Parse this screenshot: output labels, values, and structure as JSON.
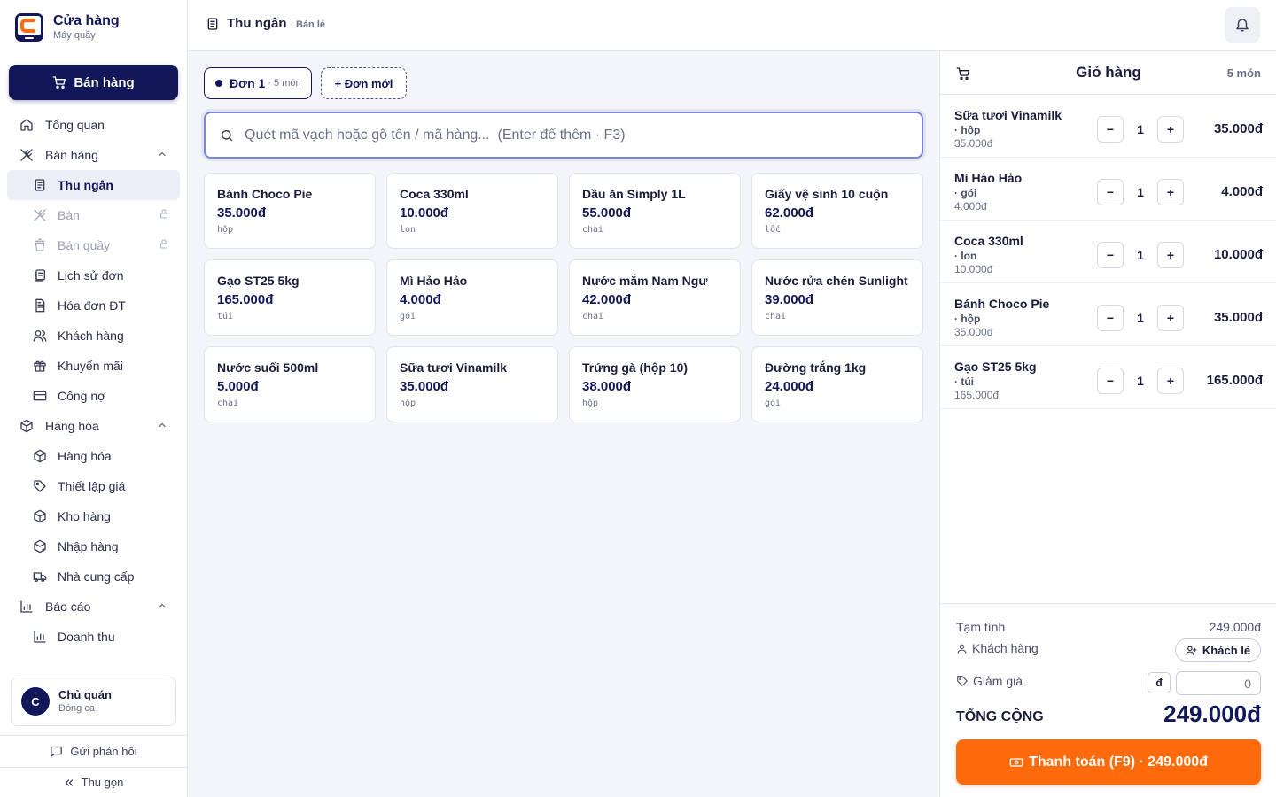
{
  "brand": {
    "name": "Cửa hàng",
    "subtitle": "Máy quầy",
    "accent": "#12175a",
    "logo_color": "#ff6a0a"
  },
  "sidebar": {
    "sell_button": "Bán hàng",
    "items": [
      {
        "label": "Tổng quan",
        "icon": "home-icon",
        "level": "top"
      },
      {
        "label": "Bán hàng",
        "icon": "fork-knife-icon",
        "level": "top",
        "expanded": true
      },
      {
        "label": "Thu ngân",
        "icon": "receipt-icon",
        "level": "sub",
        "active": true
      },
      {
        "label": "Bàn",
        "icon": "fork-knife-icon",
        "level": "sub",
        "locked": true
      },
      {
        "label": "Bán quầy",
        "icon": "cup-icon",
        "level": "sub",
        "locked": true
      },
      {
        "label": "Lịch sử đơn",
        "icon": "history-icon",
        "level": "sub"
      },
      {
        "label": "Hóa đơn ĐT",
        "icon": "invoice-icon",
        "level": "sub"
      },
      {
        "label": "Khách hàng",
        "icon": "users-icon",
        "level": "sub"
      },
      {
        "label": "Khuyến mãi",
        "icon": "gift-icon",
        "level": "sub"
      },
      {
        "label": "Công nợ",
        "icon": "card-icon",
        "level": "sub"
      },
      {
        "label": "Hàng hóa",
        "icon": "box-icon",
        "level": "top",
        "expanded": true
      },
      {
        "label": "Hàng hóa",
        "icon": "box-icon",
        "level": "sub"
      },
      {
        "label": "Thiết lập giá",
        "icon": "tag-icon",
        "level": "sub"
      },
      {
        "label": "Kho hàng",
        "icon": "box-icon",
        "level": "sub"
      },
      {
        "label": "Nhập hàng",
        "icon": "box-import-icon",
        "level": "sub"
      },
      {
        "label": "Nhà cung cấp",
        "icon": "truck-icon",
        "level": "sub"
      },
      {
        "label": "Báo cáo",
        "icon": "chart-icon",
        "level": "top",
        "expanded": true
      },
      {
        "label": "Doanh thu",
        "icon": "chart-icon",
        "level": "sub"
      }
    ],
    "user": {
      "initial": "C",
      "name": "Chủ quán",
      "status": "Đóng ca"
    },
    "feedback": "Gửi phản hồi",
    "collapse": "Thu gọn"
  },
  "topbar": {
    "title": "Thu ngân",
    "subtitle": "Bán lẻ"
  },
  "order": {
    "tab_name": "Đơn 1",
    "tab_count": "· 5 món",
    "new_label": "+ Đơn mới"
  },
  "search": {
    "placeholder": "Quét mã vạch hoặc gõ tên / mã hàng...  (Enter để thêm · F3)"
  },
  "products": [
    {
      "name": "Bánh Choco Pie",
      "price": "35.000đ",
      "unit": "hộp"
    },
    {
      "name": "Coca 330ml",
      "price": "10.000đ",
      "unit": "lon"
    },
    {
      "name": "Dầu ăn Simply 1L",
      "price": "55.000đ",
      "unit": "chai"
    },
    {
      "name": "Giấy vệ sinh 10 cuộn",
      "price": "62.000đ",
      "unit": "lốc"
    },
    {
      "name": "Gạo ST25 5kg",
      "price": "165.000đ",
      "unit": "túi"
    },
    {
      "name": "Mì Hảo Hảo",
      "price": "4.000đ",
      "unit": "gói"
    },
    {
      "name": "Nước mắm Nam Ngư",
      "price": "42.000đ",
      "unit": "chai"
    },
    {
      "name": "Nước rửa chén Sunlight",
      "price": "39.000đ",
      "unit": "chai"
    },
    {
      "name": "Nước suối 500ml",
      "price": "5.000đ",
      "unit": "chai"
    },
    {
      "name": "Sữa tươi Vinamilk",
      "price": "35.000đ",
      "unit": "hộp"
    },
    {
      "name": "Trứng gà (hộp 10)",
      "price": "38.000đ",
      "unit": "hộp"
    },
    {
      "name": "Đường trắng 1kg",
      "price": "24.000đ",
      "unit": "gói"
    }
  ],
  "cart": {
    "title": "Giỏ hàng",
    "count": "5 món",
    "items": [
      {
        "name": "Sữa tươi Vinamilk",
        "unit": "· hộp",
        "unit_price": "35.000đ",
        "qty": "1",
        "total": "35.000đ"
      },
      {
        "name": "Mì Hảo Hảo",
        "unit": "· gói",
        "unit_price": "4.000đ",
        "qty": "1",
        "total": "4.000đ"
      },
      {
        "name": "Coca 330ml",
        "unit": "· lon",
        "unit_price": "10.000đ",
        "qty": "1",
        "total": "10.000đ"
      },
      {
        "name": "Bánh Choco Pie",
        "unit": "· hộp",
        "unit_price": "35.000đ",
        "qty": "1",
        "total": "35.000đ"
      },
      {
        "name": "Gạo ST25 5kg",
        "unit": "· túi",
        "unit_price": "165.000đ",
        "qty": "1",
        "total": "165.000đ"
      }
    ],
    "minus": "−",
    "plus": "+",
    "subtotal_label": "Tạm tính",
    "subtotal": "249.000đ",
    "customer_label": "Khách hàng",
    "customer_value": "Khách lẻ",
    "discount_label": "Giảm giá",
    "discount_currency": "đ",
    "discount_value": "0",
    "total_label": "TỔNG CỘNG",
    "total": "249.000đ",
    "pay_label": "Thanh toán (F9) · 249.000đ",
    "pay_color": "#ff6a0a"
  }
}
